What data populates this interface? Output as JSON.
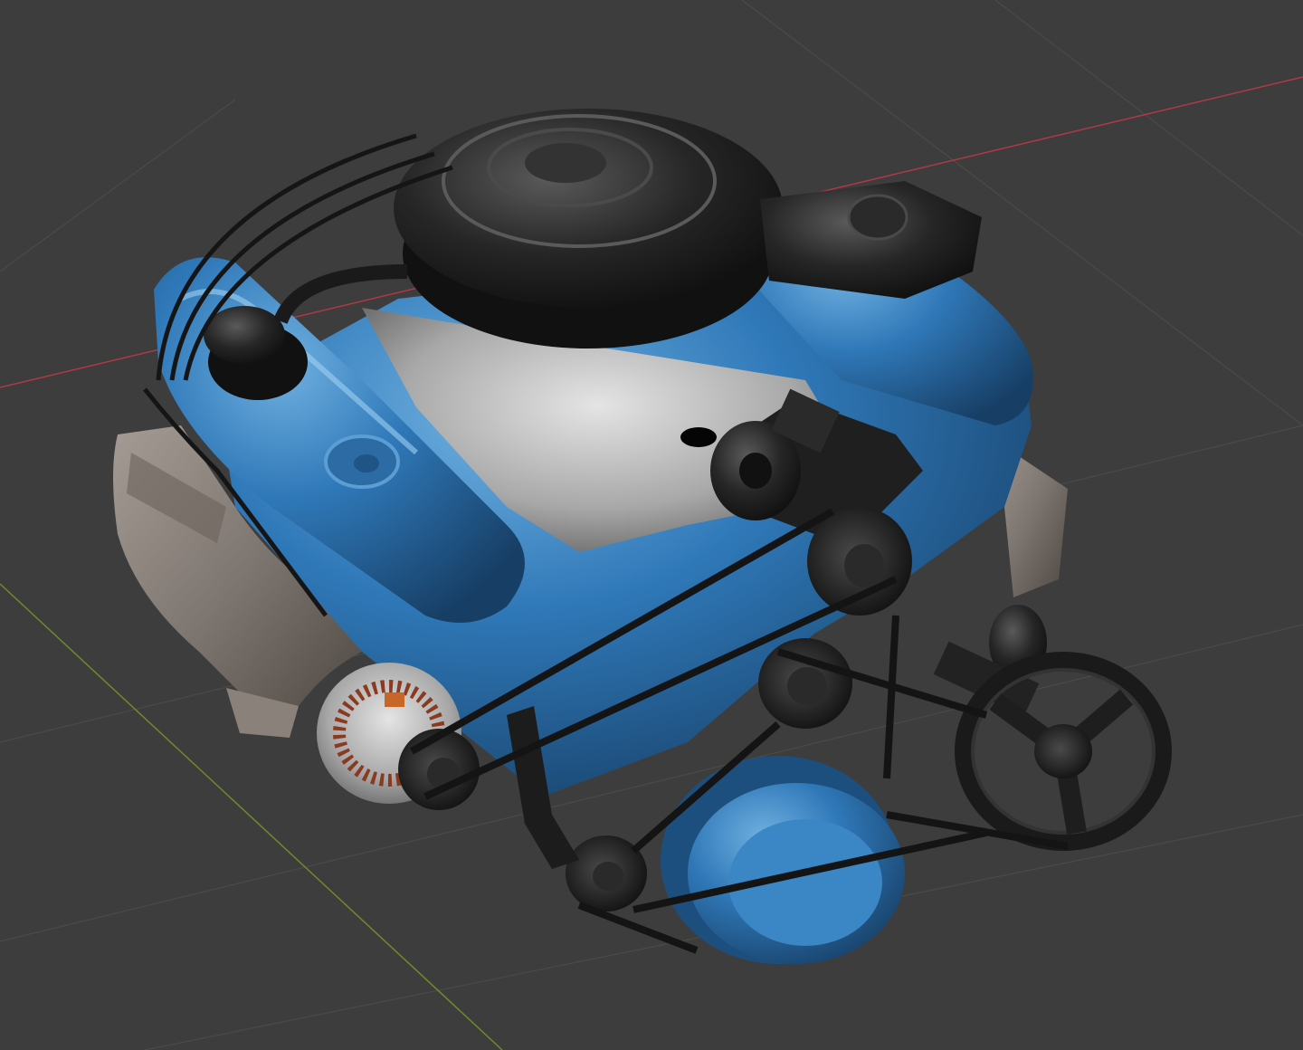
{
  "viewport": {
    "background_color": "#3d3d3d",
    "grid_color": "#4a4a4a",
    "x_axis_color": "#b03a44",
    "y_axis_color": "#6f8a2a"
  },
  "model": {
    "subject": "engine",
    "body_color": "#2f78b8",
    "body_highlight": "#6fb0e0",
    "body_shadow": "#1a4670",
    "metal_color": "#b4b4b4",
    "manifold_color": "#7e7670",
    "black_part_color": "#1c1c1c",
    "label_color": "#c8662a"
  }
}
